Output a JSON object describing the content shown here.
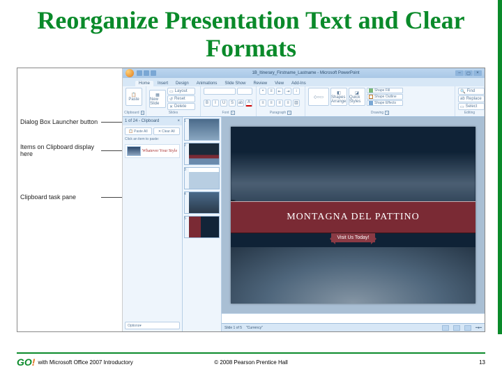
{
  "slide_title": "Reorganize Presentation Text and Clear Formats",
  "callouts": {
    "dialog_launcher": "Dialog Box Launcher button",
    "clipboard_items": "Items on Clipboard display here",
    "task_pane": "Clipboard task pane"
  },
  "app": {
    "window_title": "1B_Itinerary_Firstname_Lastname - Microsoft PowerPoint",
    "tabs": [
      "Home",
      "Insert",
      "Design",
      "Animations",
      "Slide Show",
      "Review",
      "View",
      "Add-Ins"
    ],
    "active_tab": "Home",
    "ribbon": {
      "clipboard": {
        "label": "Clipboard",
        "paste": "Paste"
      },
      "slides": {
        "label": "Slides",
        "new_slide": "New Slide",
        "layout": "Layout",
        "reset": "Reset",
        "delete": "Delete"
      },
      "font": {
        "label": "Font"
      },
      "paragraph": {
        "label": "Paragraph"
      },
      "drawing": {
        "label": "Drawing",
        "arrange": "Shapes Arrange",
        "quick": "Quick Styles",
        "fill": "Shape Fill",
        "outline": "Shape Outline",
        "effects": "Shape Effects"
      },
      "editing": {
        "label": "Editing",
        "find": "Find",
        "replace": "Replace",
        "select": "Select"
      }
    },
    "clipboard_pane": {
      "header": "1 of 24 - Clipboard",
      "paste_all": "Paste All",
      "clear_all": "Clear All",
      "hint": "Click an item to paste:",
      "item_text": "Whatever Your Style",
      "options": "Options"
    },
    "slide_content": {
      "title": "MONTAGNA DEL PATTINO",
      "visit": "Visit Us Today!"
    },
    "statusbar": {
      "slide": "Slide 1 of 5",
      "theme": "\"Currency\""
    }
  },
  "footer": {
    "logo": "GO",
    "logo_excl": "!",
    "left": "with Microsoft Office 2007 Introductory",
    "center": "© 2008 Pearson Prentice Hall",
    "page": "13"
  }
}
